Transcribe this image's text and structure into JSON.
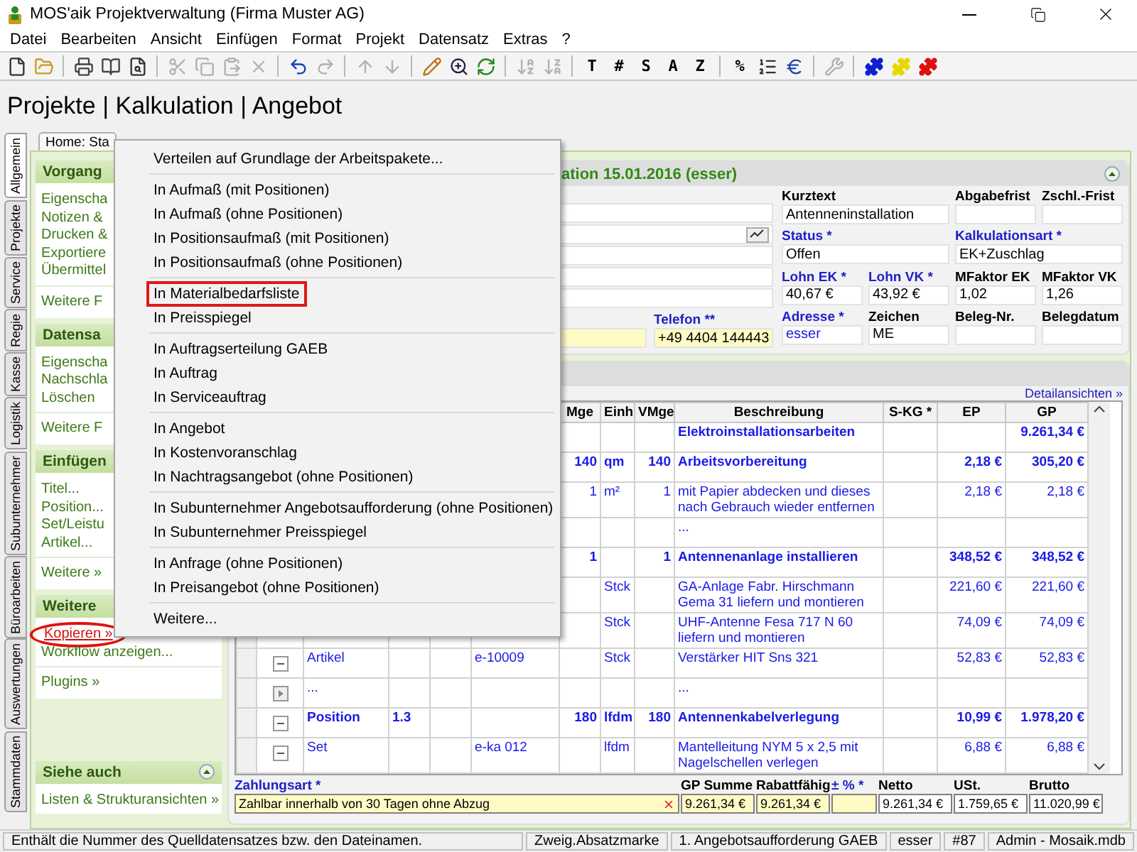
{
  "window": {
    "title": "MOS'aik Projektverwaltung (Firma Muster AG)"
  },
  "menubar": [
    "Datei",
    "Bearbeiten",
    "Ansicht",
    "Einfügen",
    "Format",
    "Projekt",
    "Datensatz",
    "Extras",
    "?"
  ],
  "toolbar": [
    {
      "kind": "new",
      "disabled": false
    },
    {
      "kind": "open",
      "disabled": false
    },
    {
      "kind": "separator"
    },
    {
      "kind": "print",
      "disabled": false
    },
    {
      "kind": "book",
      "disabled": false
    },
    {
      "kind": "preview",
      "disabled": false
    },
    {
      "kind": "separator"
    },
    {
      "kind": "cut",
      "disabled": true
    },
    {
      "kind": "copy",
      "disabled": true
    },
    {
      "kind": "paste",
      "disabled": true
    },
    {
      "kind": "delete",
      "disabled": true
    },
    {
      "kind": "separator"
    },
    {
      "kind": "undo",
      "disabled": false
    },
    {
      "kind": "redo",
      "disabled": true
    },
    {
      "kind": "separator"
    },
    {
      "kind": "up",
      "disabled": true
    },
    {
      "kind": "down",
      "disabled": true
    },
    {
      "kind": "separator"
    },
    {
      "kind": "pencil",
      "disabled": false
    },
    {
      "kind": "zoom",
      "disabled": false
    },
    {
      "kind": "refresh",
      "disabled": false
    },
    {
      "kind": "separator"
    },
    {
      "kind": "sort_az",
      "disabled": true
    },
    {
      "kind": "sort_za",
      "disabled": true
    },
    {
      "kind": "separator"
    },
    {
      "kind": "letter",
      "label": "T",
      "disabled": false
    },
    {
      "kind": "letter",
      "label": "#",
      "disabled": false
    },
    {
      "kind": "letter",
      "label": "S",
      "disabled": false
    },
    {
      "kind": "letter",
      "label": "A",
      "disabled": false
    },
    {
      "kind": "letter",
      "label": "Z",
      "disabled": false
    },
    {
      "kind": "separator"
    },
    {
      "kind": "letter",
      "label": "%",
      "disabled": false
    },
    {
      "kind": "numbering",
      "disabled": false
    },
    {
      "kind": "currency",
      "disabled": false
    },
    {
      "kind": "separator"
    },
    {
      "kind": "tool",
      "disabled": true
    },
    {
      "kind": "separator"
    },
    {
      "kind": "puzzle",
      "color": "#1020d0"
    },
    {
      "kind": "puzzle",
      "color": "#e8d800"
    },
    {
      "kind": "puzzle",
      "color": "#e01010"
    }
  ],
  "heading": "Projekte | Kalkulation | Angebot",
  "side_tabs": [
    {
      "label": "Allgemein",
      "selected": true
    },
    {
      "label": "Projekte",
      "selected": false
    },
    {
      "label": "Service",
      "selected": false
    },
    {
      "label": "Regie",
      "selected": false
    },
    {
      "label": "Kasse",
      "selected": false
    },
    {
      "label": "Logistik",
      "selected": false
    },
    {
      "label": "Subunternehmer",
      "selected": false
    },
    {
      "label": "Büroarbeiten",
      "selected": false
    },
    {
      "label": "Auswertungen",
      "selected": false
    },
    {
      "label": "Stammdaten",
      "selected": false
    }
  ],
  "doc_tabs": [
    {
      "label": "Home: Sta",
      "selected": false
    }
  ],
  "nav_panel": {
    "sections": [
      {
        "title": "Vorgang",
        "items": [
          {
            "label": "Eigenscha",
            "circled": false
          },
          {
            "label": "Notizen &",
            "circled": false
          },
          {
            "label": "Drucken &",
            "circled": false
          },
          {
            "label": "Exportiere",
            "circled": false
          },
          {
            "label": "Übermittel",
            "circled": false
          }
        ],
        "more": "Weitere F"
      },
      {
        "title": "Datensa",
        "items": [
          {
            "label": "Eigenscha",
            "circled": false
          },
          {
            "label": "Nachschla",
            "circled": false
          },
          {
            "label": "Löschen",
            "circled": false
          }
        ],
        "more": "Weitere F"
      },
      {
        "title": "Einfügen",
        "items": [
          {
            "label": "Titel...",
            "circled": false
          },
          {
            "label": "Position...",
            "circled": false
          },
          {
            "label": "Set/Leistu",
            "circled": false
          },
          {
            "label": "Artikel...",
            "circled": false
          }
        ],
        "more": "Weitere »"
      },
      {
        "title": "Weitere",
        "items": [
          {
            "label": "Kopieren »",
            "circled": true
          },
          {
            "label": "Workflow anzeigen...",
            "circled": false
          }
        ],
        "more": "Plugins »"
      },
      {
        "title": "Siehe auch",
        "collapse_button": true,
        "items": [
          {
            "label": "Listen & Strukturansichten »",
            "circled": false
          }
        ]
      }
    ]
  },
  "record_panel": {
    "title": "ation 15.01.2016 (esser)",
    "left_fields": [
      {
        "kind": "text"
      },
      {
        "kind": "picker"
      },
      {
        "kind": "text"
      },
      {
        "kind": "text"
      },
      {
        "kind": "text"
      }
    ],
    "contact_row": {
      "field": {
        "highlight": true
      },
      "phone": {
        "label": "Telefon **",
        "value": "+49 4404 144443",
        "required": true,
        "highlight": true
      }
    },
    "grid": [
      [
        {
          "label": "Kurztext",
          "value": "Antenneninstallation",
          "required": false,
          "wide": true
        },
        {
          "label": "Abgabefrist",
          "required": false,
          "wide": false
        },
        {
          "label": "Zschl.-Frist",
          "required": false,
          "wide": false
        }
      ],
      [
        {
          "label": "Status *",
          "value": "Offen",
          "required": true,
          "wide": true
        },
        {
          "label": "Kalkulationsart *",
          "value": "EK+Zuschlag",
          "required": true,
          "wide": true
        }
      ],
      [
        {
          "label": "Lohn EK *",
          "value": "40,67 €",
          "required": true,
          "wide": false
        },
        {
          "label": "Lohn VK *",
          "value": "43,92 €",
          "required": true,
          "wide": false
        },
        {
          "label": "MFaktor EK",
          "value": "1,02",
          "required": false,
          "wide": false
        },
        {
          "label": "MFaktor VK",
          "value": "1,26",
          "required": false,
          "wide": false
        }
      ],
      [
        {
          "label": "Adresse *",
          "value": "esser",
          "required": true,
          "wide": false,
          "link": true
        },
        {
          "label": "Zeichen",
          "value": "ME",
          "required": false,
          "wide": false,
          "link": false
        },
        {
          "label": "Beleg-Nr.",
          "required": false,
          "wide": false
        },
        {
          "label": "Belegdatum",
          "required": false,
          "wide": false
        }
      ]
    ]
  },
  "positions_panel": {
    "link": "Detailansichten »",
    "table": {
      "columns": [
        "Mge",
        "Einh",
        "VMge",
        "Beschreibung",
        "S-KG *",
        "EP",
        "GP"
      ],
      "rows": [
        {
          "kind": "group",
          "beschreibung": "Elektroinstallationsarbeiten",
          "gp": "9.261,34 €"
        },
        {
          "kind": "group",
          "mge": "140",
          "einh": "qm",
          "vmge": "140",
          "beschreibung": "Arbeitsvorbereitung",
          "ep": "2,18 €",
          "gp": "305,20 €"
        },
        {
          "kind": "item",
          "mge": "1",
          "einh": "m²",
          "vmge": "1",
          "beschreibung": "mit Papier abdecken und dieses nach Gebrauch wieder entfernen",
          "ep": "2,18 €",
          "gp": "2,18 €"
        },
        {
          "kind": "item",
          "beschreibung": "..."
        },
        {
          "kind": "group",
          "mge": "1",
          "vmge": "1",
          "beschreibung": "Antennenanlage installieren",
          "ep": "348,52 €",
          "gp": "348,52 €"
        },
        {
          "kind": "item",
          "einh": "Stck",
          "beschreibung": "GA-Anlage Fabr. Hirschmann Gema 31 liefern und montieren",
          "ep": "221,60 €",
          "gp": "221,60 €"
        },
        {
          "kind": "item",
          "einh": "Stck",
          "beschreibung": "UHF-Antenne Fesa 717 N 60 liefern und montieren",
          "ep": "74,09 €",
          "gp": "74,09 €"
        },
        {
          "kind": "item",
          "expanded": true,
          "column_3": "Artikel",
          "column_6": "e-10009",
          "einh": "Stck",
          "beschreibung": "Verstärker HIT Sns 321",
          "ep": "52,83 €",
          "gp": "52,83 €"
        },
        {
          "kind": "item",
          "expanded": false,
          "column_3": "...",
          "beschreibung": "..."
        },
        {
          "kind": "group",
          "expanded": true,
          "column_3": "Position",
          "column_4": "1.3",
          "mge": "180",
          "einh": "lfdm",
          "vmge": "180",
          "beschreibung": "Antennenkabelverlegung",
          "ep": "10,99 €",
          "gp": "1.978,20 €"
        },
        {
          "kind": "item",
          "expanded": true,
          "column_3": "Set",
          "column_6": "e-ka 012",
          "einh": "lfdm",
          "beschreibung": "Mantelleitung NYM 5 x 2,5 mit Nagelschellen verlegen",
          "ep": "6,88 €",
          "gp": "6,88 €"
        }
      ]
    },
    "payment": {
      "label": "Zahlungsart *",
      "value": "Zahlbar innerhalb von 30 Tagen ohne Abzug"
    },
    "totals": [
      {
        "label": "GP Summe",
        "value": "9.261,34 €",
        "required": false
      },
      {
        "label": "Rabattfähig",
        "value": "9.261,34 €",
        "required": false
      },
      {
        "label": "± % *",
        "required": true
      },
      {
        "label": "Netto",
        "value": "9.261,34 €",
        "required": false
      },
      {
        "label": "USt.",
        "value": "1.759,65 €",
        "required": false
      },
      {
        "label": "Brutto",
        "value": "11.020,99 €",
        "required": false
      }
    ]
  },
  "context_menu": {
    "groups": [
      {
        "items": [
          {
            "label": "Verteilen auf Grundlage der Arbeitspakete...",
            "highlighted": false
          }
        ]
      },
      {
        "items": [
          {
            "label": "In Aufmaß (mit Positionen)",
            "highlighted": false
          },
          {
            "label": "In Aufmaß (ohne Positionen)",
            "highlighted": false
          },
          {
            "label": "In Positionsaufmaß (mit Positionen)",
            "highlighted": false
          },
          {
            "label": "In Positionsaufmaß (ohne Positionen)",
            "highlighted": false
          }
        ]
      },
      {
        "items": [
          {
            "label": "In Materialbedarfsliste",
            "highlighted": true
          },
          {
            "label": "In Preisspiegel",
            "highlighted": false
          }
        ]
      },
      {
        "items": [
          {
            "label": "In Auftragserteilung GAEB",
            "highlighted": false
          },
          {
            "label": "In Auftrag",
            "highlighted": false
          },
          {
            "label": "In Serviceauftrag",
            "highlighted": false
          }
        ]
      },
      {
        "items": [
          {
            "label": "In Angebot",
            "highlighted": false
          },
          {
            "label": "In Kostenvoranschlag",
            "highlighted": false
          },
          {
            "label": "In Nachtragsangebot (ohne Positionen)",
            "highlighted": false
          }
        ]
      },
      {
        "items": [
          {
            "label": "In Subunternehmer Angebotsaufforderung (ohne Positionen)",
            "highlighted": false
          },
          {
            "label": "In Subunternehmer Preisspiegel",
            "highlighted": false
          }
        ]
      },
      {
        "items": [
          {
            "label": "In Anfrage (ohne Positionen)",
            "highlighted": false
          },
          {
            "label": "In Preisangebot (ohne Positionen)",
            "highlighted": false
          }
        ]
      },
      {
        "items": [
          {
            "label": "Weitere...",
            "highlighted": false
          }
        ]
      }
    ]
  },
  "status_bar": [
    "Enthält die Nummer des Quelldatensatzes bzw. den Dateinamen.",
    "Zweig.Absatzmarke",
    "1. Angebotsaufforderung GAEB",
    "esser",
    "#87",
    "Admin - Mosaik.mdb"
  ]
}
